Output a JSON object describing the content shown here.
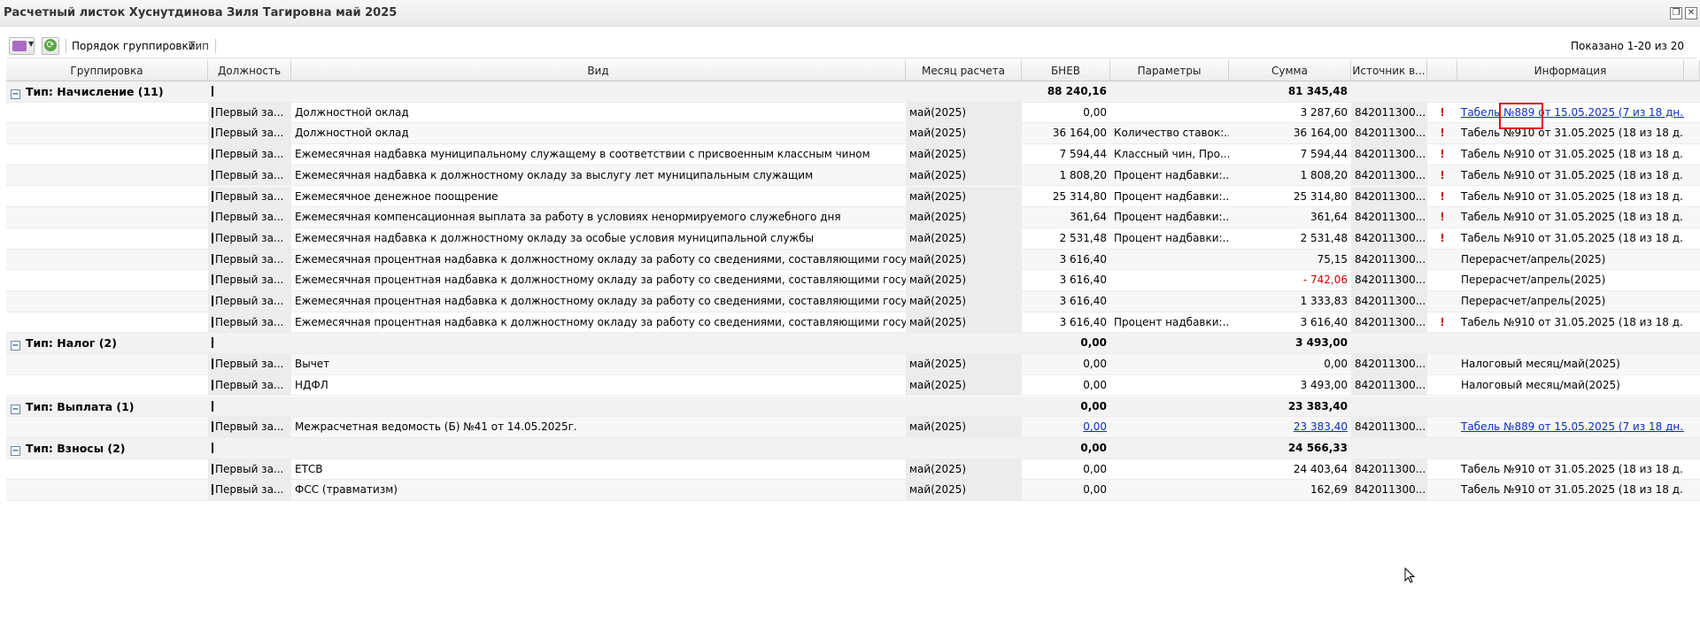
{
  "window": {
    "title": "Расчетный листок Хуснутдинова Зиля Тагировна май 2025"
  },
  "toolbar": {
    "grouping_label": "Порядок группировки:",
    "grouping_value": "Тип",
    "shown": "Показано 1-20 из 20"
  },
  "columns": [
    "Группировка",
    "Должность",
    "Вид",
    "Месяц расчета",
    "БНЕВ",
    "Параметры",
    "Сумма",
    "Источник в...",
    "Информация"
  ],
  "groups": [
    {
      "label": "Тип: Начисление (11)",
      "bnev": "88 240,16",
      "sum": "81 345,48",
      "rows": [
        {
          "pos": "Первый за...",
          "kind": "Должностной оклад",
          "month": "май(2025)",
          "bnev": "0,00",
          "params": "",
          "sum": "3 287,60",
          "source": "842011300...",
          "flag": "!",
          "info": "Табель №889 от 15.05.2025 (7 из 18 дн...",
          "info_link": true,
          "sum_link": false,
          "neg": false
        },
        {
          "pos": "Первый за...",
          "kind": "Должностной оклад",
          "month": "май(2025)",
          "bnev": "36 164,00",
          "params": "Количество ставок:...",
          "sum": "36 164,00",
          "source": "842011300...",
          "flag": "!",
          "info": "Табель №910 от 31.05.2025 (18 из 18 д...",
          "info_link": false,
          "sum_link": false,
          "neg": false
        },
        {
          "pos": "Первый за...",
          "kind": "Ежемесячная надбавка муниципальному служащему в соответствии с присвоенным классным чином",
          "month": "май(2025)",
          "bnev": "7 594,44",
          "params": "Классный чин, Про...",
          "sum": "7 594,44",
          "source": "842011300...",
          "flag": "!",
          "info": "Табель №910 от 31.05.2025 (18 из 18 д...",
          "info_link": false,
          "sum_link": false,
          "neg": false
        },
        {
          "pos": "Первый за...",
          "kind": "Ежемесячная надбавка к должностному окладу за выслугу лет муниципальным служащим",
          "month": "май(2025)",
          "bnev": "1 808,20",
          "params": "Процент надбавки:...",
          "sum": "1 808,20",
          "source": "842011300...",
          "flag": "!",
          "info": "Табель №910 от 31.05.2025 (18 из 18 д...",
          "info_link": false,
          "sum_link": false,
          "neg": false
        },
        {
          "pos": "Первый за...",
          "kind": "Ежемесячное денежное поощрение",
          "month": "май(2025)",
          "bnev": "25 314,80",
          "params": "Процент надбавки:...",
          "sum": "25 314,80",
          "source": "842011300...",
          "flag": "!",
          "info": "Табель №910 от 31.05.2025 (18 из 18 д...",
          "info_link": false,
          "sum_link": false,
          "neg": false
        },
        {
          "pos": "Первый за...",
          "kind": "Ежемесячная компенсационная выплата за работу в условиях ненормируемого служебного дня",
          "month": "май(2025)",
          "bnev": "361,64",
          "params": "Процент надбавки:...",
          "sum": "361,64",
          "source": "842011300...",
          "flag": "!",
          "info": "Табель №910 от 31.05.2025 (18 из 18 д...",
          "info_link": false,
          "sum_link": false,
          "neg": false
        },
        {
          "pos": "Первый за...",
          "kind": "Ежемесячная надбавка к должностному окладу за особые условия муниципальной службы",
          "month": "май(2025)",
          "bnev": "2 531,48",
          "params": "Процент надбавки:...",
          "sum": "2 531,48",
          "source": "842011300...",
          "flag": "!",
          "info": "Табель №910 от 31.05.2025 (18 из 18 д...",
          "info_link": false,
          "sum_link": false,
          "neg": false
        },
        {
          "pos": "Первый за...",
          "kind": "Ежемесячная процентная надбавка к должностному окладу за работу со сведениями, составляющими государствен...",
          "month": "май(2025)",
          "bnev": "3 616,40",
          "params": "",
          "sum": "75,15",
          "source": "842011300...",
          "flag": "",
          "info": "Перерасчет/апрель(2025)",
          "info_link": false,
          "sum_link": false,
          "neg": false
        },
        {
          "pos": "Первый за...",
          "kind": "Ежемесячная процентная надбавка к должностному окладу за работу со сведениями, составляющими государствен...",
          "month": "май(2025)",
          "bnev": "3 616,40",
          "params": "",
          "sum": "- 742,06",
          "source": "842011300...",
          "flag": "",
          "info": "Перерасчет/апрель(2025)",
          "info_link": false,
          "sum_link": false,
          "neg": true
        },
        {
          "pos": "Первый за...",
          "kind": "Ежемесячная процентная надбавка к должностному окладу за работу со сведениями, составляющими государствен...",
          "month": "май(2025)",
          "bnev": "3 616,40",
          "params": "",
          "sum": "1 333,83",
          "source": "842011300...",
          "flag": "",
          "info": "Перерасчет/апрель(2025)",
          "info_link": false,
          "sum_link": false,
          "neg": false
        },
        {
          "pos": "Первый за...",
          "kind": "Ежемесячная процентная надбавка к должностному окладу за работу со сведениями, составляющими государствен...",
          "month": "май(2025)",
          "bnev": "3 616,40",
          "params": "Процент надбавки:...",
          "sum": "3 616,40",
          "source": "842011300...",
          "flag": "!",
          "info": "Табель №910 от 31.05.2025 (18 из 18 д...",
          "info_link": false,
          "sum_link": false,
          "neg": false
        }
      ]
    },
    {
      "label": "Тип: Налог (2)",
      "bnev": "0,00",
      "sum": "3 493,00",
      "rows": [
        {
          "pos": "Первый за...",
          "kind": "Вычет",
          "month": "май(2025)",
          "bnev": "0,00",
          "params": "",
          "sum": "0,00",
          "source": "842011300...",
          "flag": "",
          "info": "Налоговый месяц/май(2025)",
          "info_link": false,
          "sum_link": false,
          "neg": false
        },
        {
          "pos": "Первый за...",
          "kind": "НДФЛ",
          "month": "май(2025)",
          "bnev": "0,00",
          "params": "",
          "sum": "3 493,00",
          "source": "842011300...",
          "flag": "",
          "info": "Налоговый месяц/май(2025)",
          "info_link": false,
          "sum_link": false,
          "neg": false
        }
      ]
    },
    {
      "label": "Тип: Выплата (1)",
      "bnev": "0,00",
      "sum": "23 383,40",
      "rows": [
        {
          "pos": "Первый за...",
          "kind": "Межрасчетная ведомость (Б) №41 от 14.05.2025г.",
          "month": "май(2025)",
          "bnev": "0,00",
          "params": "",
          "sum": "23 383,40",
          "source": "842011300...",
          "flag": "",
          "info": "Табель №889 от 15.05.2025 (7 из 18 дн...",
          "info_link": true,
          "sum_link": true,
          "neg": false
        }
      ]
    },
    {
      "label": "Тип: Взносы (2)",
      "bnev": "0,00",
      "sum": "24 566,33",
      "rows": [
        {
          "pos": "Первый за...",
          "kind": "ЕТСВ",
          "month": "май(2025)",
          "bnev": "0,00",
          "params": "",
          "sum": "24 403,64",
          "source": "842011300...",
          "flag": "",
          "info": "Табель №910 от 31.05.2025 (18 из 18 д...",
          "info_link": false,
          "sum_link": false,
          "neg": false
        },
        {
          "pos": "Первый за...",
          "kind": "ФСС (травматизм)",
          "month": "май(2025)",
          "bnev": "0,00",
          "params": "",
          "sum": "162,69",
          "source": "842011300...",
          "flag": "",
          "info": "Табель №910 от 31.05.2025 (18 из 18 д...",
          "info_link": false,
          "sum_link": false,
          "neg": false
        }
      ]
    }
  ],
  "icons": {
    "menu": "actions-menu-icon",
    "refresh": "refresh-icon",
    "restore": "restore-window-icon",
    "close": "close-icon",
    "collapse": "collapse-group-icon",
    "cursor": "mouse-cursor-icon"
  }
}
